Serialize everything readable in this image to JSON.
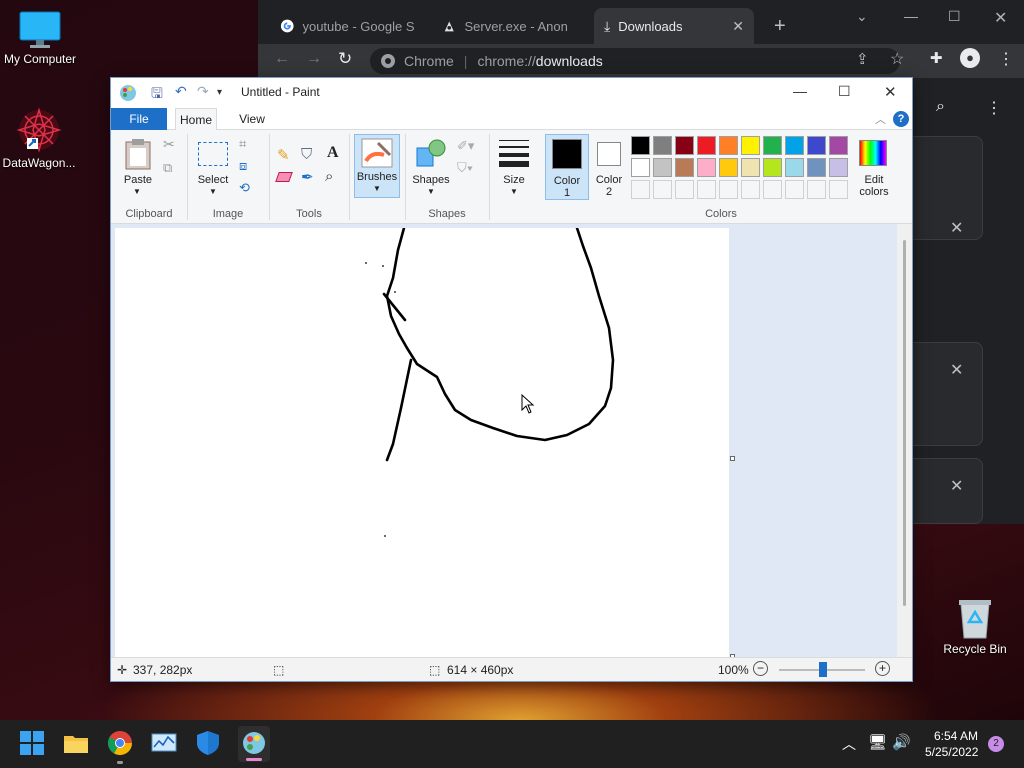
{
  "desktop": {
    "icons": [
      {
        "label": "My Computer"
      },
      {
        "label": "DataWagon..."
      },
      {
        "label": "Recycle Bin"
      }
    ]
  },
  "chrome": {
    "tabs": [
      {
        "title": "youtube - Google S"
      },
      {
        "title": "Server.exe - Anon"
      },
      {
        "title": "Downloads"
      }
    ],
    "omnibox": {
      "scheme": "Chrome",
      "separator": "|",
      "prefix": "chrome://",
      "host": "downloads"
    }
  },
  "paint": {
    "title": "Untitled - Paint",
    "menu": {
      "file": "File",
      "home": "Home",
      "view": "View"
    },
    "ribbon": {
      "clipboard": {
        "paste": "Paste",
        "group": "Clipboard"
      },
      "image": {
        "select": "Select",
        "group": "Image"
      },
      "tools": {
        "group": "Tools"
      },
      "brushes": {
        "label": "Brushes"
      },
      "shapes": {
        "label": "Shapes",
        "group": "Shapes"
      },
      "size": {
        "label": "Size"
      },
      "color1": {
        "label1": "Color",
        "label2": "1",
        "value": "#000000"
      },
      "color2": {
        "label1": "Color",
        "label2": "2",
        "value": "#ffffff"
      },
      "colors": {
        "group": "Colors",
        "edit1": "Edit",
        "edit2": "colors"
      },
      "palette_row1": [
        "#000000",
        "#7f7f7f",
        "#880015",
        "#ed1c24",
        "#ff7f27",
        "#fff200",
        "#22b14c",
        "#00a2e8",
        "#3f48cc",
        "#a349a4"
      ],
      "palette_row2": [
        "#ffffff",
        "#c3c3c3",
        "#b97a57",
        "#ffaec9",
        "#ffc90e",
        "#efe4b0",
        "#b5e61d",
        "#99d9ea",
        "#7092be",
        "#c8bfe7"
      ]
    },
    "status": {
      "cursor_pos": "337, 282px",
      "canvas_size": "614 × 460px",
      "zoom": "100%"
    }
  },
  "taskbar": {
    "time": "6:54 AM",
    "date": "5/25/2022",
    "notifications": "2"
  }
}
